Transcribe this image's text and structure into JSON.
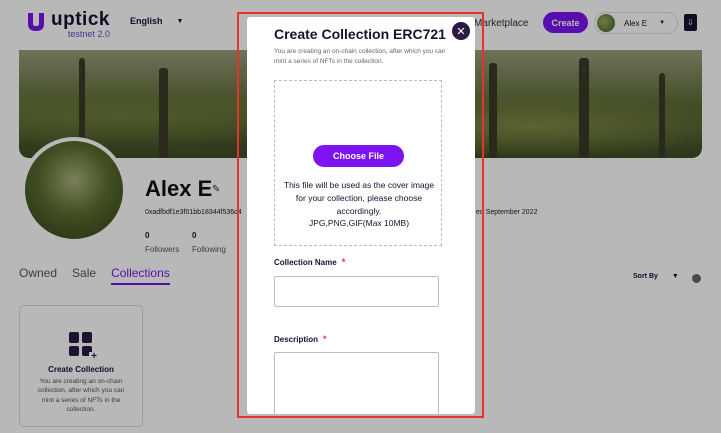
{
  "header": {
    "logo_name": "uptick",
    "logo_sub": "testnet 2.0",
    "language": "English",
    "nav_link": "Marketplace",
    "create_label": "Create",
    "user_name": "Alex E"
  },
  "profile": {
    "name": "Alex E",
    "address": "0xadfbdf1e3f01bb18344f536d4",
    "joined": "ed September 2022",
    "followers_count": "0",
    "followers_label": "Followers",
    "following_count": "0",
    "following_label": "Following"
  },
  "tabs": [
    {
      "label": "Owned"
    },
    {
      "label": "Sale"
    },
    {
      "label": "Collections"
    }
  ],
  "sort_label": "Sort By",
  "collection_card": {
    "title": "Create Collection",
    "description": "You are creating an on-chain collection, after which you can mint a series of NFTs in the collection."
  },
  "modal": {
    "title": "Create Collection ERC721",
    "subtitle": "You are creating an on-chain collection, after which you can mint a series of NFTs in the collection.",
    "choose_file_label": "Choose File",
    "drop_text_1": "This file will be used as the cover image",
    "drop_text_2": "for your collection, please choose",
    "drop_text_3": "accordingly.",
    "drop_text_4": "JPG,PNG,GIF(Max 10MB)",
    "collection_name_label": "Collection Name",
    "description_label": "Description",
    "required_mark": "*",
    "collection_name_value": "",
    "description_value": ""
  },
  "colors": {
    "accent": "#7b14f0",
    "dark": "#1a1033",
    "required": "#e8322b",
    "highlight_frame": "#e8322b"
  },
  "icons": {
    "close": "close-icon",
    "edit": "pencil-icon",
    "collection": "grid-plus-icon",
    "wallet": "wallet-icon"
  }
}
